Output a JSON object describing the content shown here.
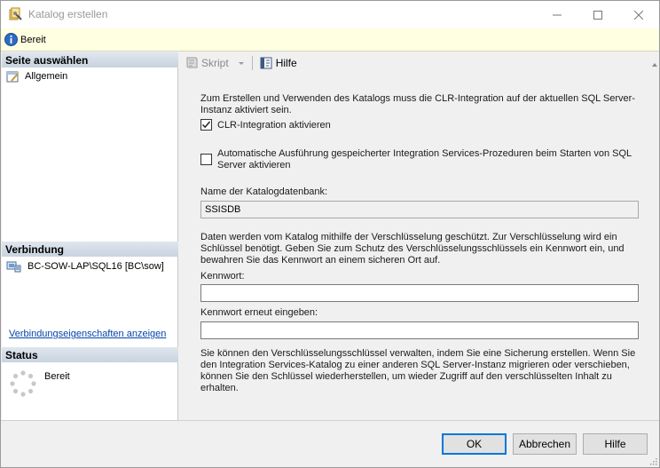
{
  "window": {
    "title": "Katalog erstellen",
    "icon": "catalog-icon",
    "controls": [
      "minimize-icon",
      "maximize-icon",
      "close-icon"
    ]
  },
  "infobar": {
    "icon": "info-icon",
    "text": "Bereit"
  },
  "left": {
    "select_page_header": "Seite auswählen",
    "pages": [
      {
        "label": "Allgemein",
        "icon": "page-wrench-icon"
      }
    ],
    "connection_header": "Verbindung",
    "connection": {
      "text": "BC-SOW-LAP\\SQL16 [BC\\sow]",
      "icon": "server-connection-icon"
    },
    "connection_link": "Verbindungseigenschaften anzeigen",
    "status_header": "Status",
    "status": {
      "text": "Bereit",
      "icon": "progress-spinner-icon"
    }
  },
  "toolbar": {
    "skript_label": "Skript",
    "hilfe_label": "Hilfe"
  },
  "form": {
    "clr_text": "Zum Erstellen und Verwenden des Katalogs muss die CLR-Integration auf der aktuellen SQL Server-Instanz aktiviert sein.",
    "clr_checkbox": {
      "label": "CLR-Integration aktivieren",
      "checked": true
    },
    "auto_checkbox": {
      "label": "Automatische Ausführung gespeicherter Integration Services-Prozeduren beim Starten von SQL Server aktivieren",
      "checked": false
    },
    "db_name_label": "Name der Katalogdatenbank:",
    "db_name_value": "SSISDB",
    "encryption_text": "Daten werden vom Katalog mithilfe der Verschlüsselung geschützt. Zur Verschlüsselung wird ein Schlüssel benötigt. Geben Sie zum Schutz des Verschlüsselungsschlüssels ein Kennwort ein, und bewahren Sie das Kennwort an einem sicheren Ort auf.",
    "password_label": "Kennwort:",
    "password_value": "",
    "password_confirm_label": "Kennwort erneut eingeben:",
    "password_confirm_value": "",
    "backup_text": "Sie können den Verschlüsselungsschlüssel verwalten, indem Sie eine Sicherung erstellen. Wenn Sie den Integration Services-Katalog zu einer anderen SQL Server-Instanz migrieren oder verschieben, können Sie den Schlüssel wiederherstellen, um wieder Zugriff auf den verschlüsselten Inhalt zu erhalten."
  },
  "buttons": {
    "ok": "OK",
    "cancel": "Abbrechen",
    "help": "Hilfe"
  },
  "colors": {
    "accent": "#0078d7",
    "link": "#0645ad",
    "infobar_bg": "#ffffe1"
  }
}
